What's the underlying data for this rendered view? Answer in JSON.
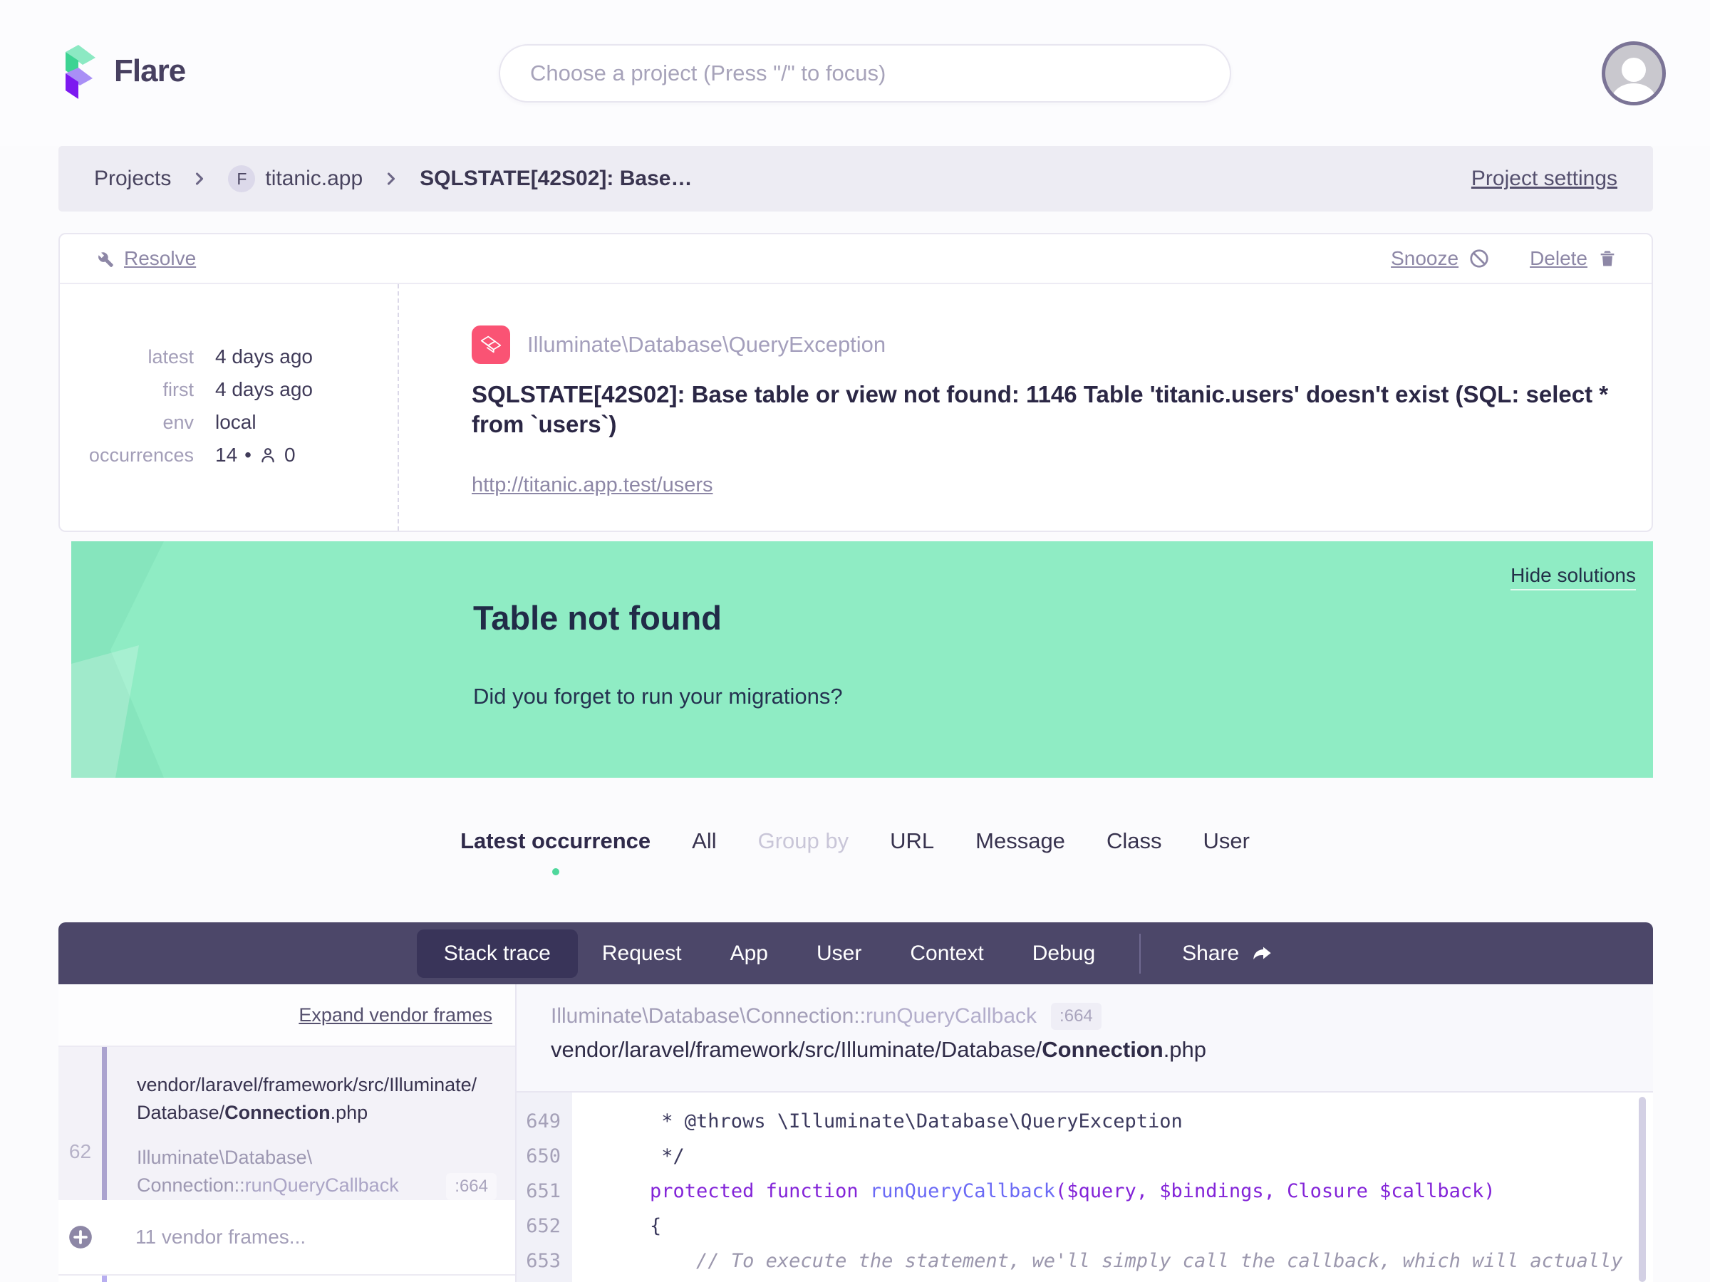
{
  "header": {
    "brand": "Flare",
    "search_placeholder": "Choose a project (Press \"/\" to focus)"
  },
  "breadcrumb": {
    "root": "Projects",
    "project_badge_letter": "F",
    "project": "titanic.app",
    "current": "SQLSTATE[42S02]: Base…",
    "settings_label": "Project settings"
  },
  "error_card": {
    "actions": {
      "resolve": "Resolve",
      "snooze": "Snooze",
      "delete": "Delete"
    },
    "meta": {
      "latest": {
        "label": "latest",
        "value": "4 days ago"
      },
      "first": {
        "label": "first",
        "value": "4 days ago"
      },
      "env": {
        "label": "env",
        "value": "local"
      },
      "occurrences": {
        "label": "occurrences",
        "count": "14",
        "sep": "•",
        "users": "0"
      }
    },
    "exception_class": "Illuminate\\Database\\QueryException",
    "message": "SQLSTATE[42S02]: Base table or view not found: 1146 Table 'titanic.users' doesn't exist (SQL: select * from `users`)",
    "url": "http://titanic.app.test/users"
  },
  "solution": {
    "hide_label": "Hide solutions",
    "title": "Table not found",
    "description": "Did you forget to run your migrations?"
  },
  "occurrence_tabs": [
    {
      "label": "Latest occurrence",
      "state": "active"
    },
    {
      "label": "All",
      "state": "normal"
    },
    {
      "label": "Group by",
      "state": "muted"
    },
    {
      "label": "URL",
      "state": "normal"
    },
    {
      "label": "Message",
      "state": "normal"
    },
    {
      "label": "Class",
      "state": "normal"
    },
    {
      "label": "User",
      "state": "normal"
    }
  ],
  "trace_nav": {
    "tabs": [
      {
        "label": "Stack trace",
        "active": true
      },
      {
        "label": "Request",
        "active": false
      },
      {
        "label": "App",
        "active": false
      },
      {
        "label": "User",
        "active": false
      },
      {
        "label": "Context",
        "active": false
      },
      {
        "label": "Debug",
        "active": false
      }
    ],
    "share_label": "Share"
  },
  "stack": {
    "expand_label": "Expand vendor frames",
    "selected_frame": {
      "number": "62",
      "path_line1": "vendor/laravel/framework/src/Illuminate/",
      "path_line2_pre": "Database/",
      "file_bold": "Connection",
      "file_ext": ".php",
      "class_line1": "Illuminate\\Database\\",
      "class_line2_pre": "Connection::",
      "method": "runQueryCallback",
      "line_badge": ":664"
    },
    "vendor_label": "11 vendor frames..."
  },
  "code": {
    "header_class_pre": "Illuminate\\Database\\Connection::",
    "header_method": "runQueryCallback",
    "header_badge": ":664",
    "header_file_pre": "vendor/laravel/framework/src/Illuminate/Database/",
    "header_file_bold": "Connection",
    "header_file_ext": ".php",
    "lines": [
      {
        "no": "649",
        "tokens": [
          {
            "t": "     * @throws \\Illuminate\\Database\\QueryException",
            "c": "plain"
          }
        ]
      },
      {
        "no": "650",
        "tokens": [
          {
            "t": "     */",
            "c": "plain"
          }
        ]
      },
      {
        "no": "651",
        "tokens": [
          {
            "t": "    ",
            "c": "plain"
          },
          {
            "t": "protected function ",
            "c": "kw"
          },
          {
            "t": "runQueryCallback",
            "c": "fn"
          },
          {
            "t": "($query, $bindings, Closure $callback)",
            "c": "kw"
          }
        ]
      },
      {
        "no": "652",
        "tokens": [
          {
            "t": "    {",
            "c": "plain"
          }
        ]
      },
      {
        "no": "653",
        "tokens": [
          {
            "t": "        ",
            "c": "plain"
          },
          {
            "t": "// To execute the statement, we'll simply call the callback, which will actually",
            "c": "comment"
          }
        ]
      }
    ]
  }
}
